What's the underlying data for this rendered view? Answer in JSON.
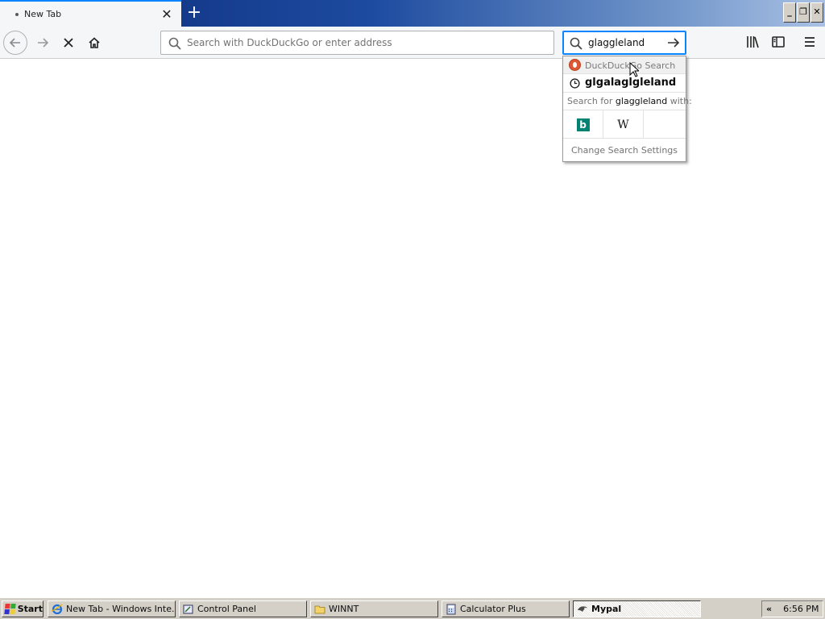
{
  "tab": {
    "title": "New Tab",
    "close": "✕",
    "new": "+"
  },
  "window_controls": {
    "minimize": "_",
    "restore": "❐",
    "close": "✕"
  },
  "urlbar": {
    "placeholder": "Search with DuckDuckGo or enter address",
    "value": ""
  },
  "searchbar": {
    "value": "glaggleland"
  },
  "search_popup": {
    "engine_header": "DuckDuckGo Search",
    "suggestion": "glgalaglgleland",
    "search_for_prefix": "Search for ",
    "search_for_query": "glaggleland",
    "search_for_suffix": " with:",
    "engines": [
      {
        "name": "bing-icon",
        "glyph": "b"
      },
      {
        "name": "wikipedia-icon",
        "glyph": "W"
      }
    ],
    "change_settings": "Change Search Settings"
  },
  "taskbar": {
    "start": "Start",
    "items": [
      {
        "label": "New Tab - Windows Inte...",
        "icon": "ie-icon"
      },
      {
        "label": "Control Panel",
        "icon": "control-panel-icon"
      },
      {
        "label": "WINNT",
        "icon": "folder-icon"
      },
      {
        "label": "Calculator Plus",
        "icon": "calculator-icon"
      },
      {
        "label": "Mypal",
        "icon": "mypal-icon"
      }
    ],
    "tray_chevron": "«",
    "clock": "6:56 PM"
  },
  "colors": {
    "accent": "#0a84ff",
    "tab_bg": "#f5f6f7",
    "taskbar": "#d4d0c8"
  }
}
